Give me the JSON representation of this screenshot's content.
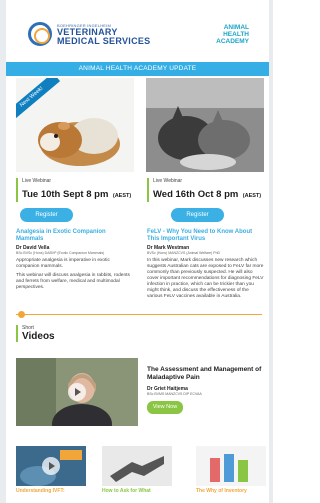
{
  "header": {
    "brand_small": "BOEHRINGER INGELHEIM",
    "brand_line1": "VETERINARY",
    "brand_line2": "MEDICAL SERVICES",
    "academy_line1": "ANIMAL",
    "academy_line2": "HEALTH",
    "academy_line3": "ACADEMY"
  },
  "banner": {
    "title": "ANIMAL HEALTH ACADEMY UPDATE"
  },
  "hero": {
    "ribbon": "Next Week!"
  },
  "webinars": [
    {
      "type": "Live Webinar",
      "date": "Tue 10th Sept 8 pm",
      "tz": "(AEST)",
      "button": "Register",
      "title": "Analgesia in Exotic Companion Mammals",
      "presenter": "Dr David Vella",
      "creds": "BSc BVSc (Hons) DABVP (Exotic Companion Mammals)",
      "paragraphs": [
        "Appropriate analgesia is imperative in exotic companion mammals.",
        "This webinar will discuss analgesia in rabbits, rodents and ferrets from welfare, medical and multimodal perspectives."
      ]
    },
    {
      "type": "Live Webinar",
      "date": "Wed 16th Oct 8 pm",
      "tz": "(AEST)",
      "button": "Register",
      "title": "FeLV - Why You Need to Know About This Important Virus",
      "presenter": "Dr Mark Westman",
      "creds": "BVSc (Hons) MANZCVS (Animal Welfare) PhD",
      "paragraphs": [
        "In this webinar, Mark discusses new research which suggests Australian cats are exposed to FeLV far more commonly than previously suspected. He will also cover important recommendations for diagnosing FeLV infection in practice, which can be trickier than you might think, and discuss the effectiveness of the various FeLV vaccines available in Australia."
      ]
    }
  ],
  "videos": {
    "label": "Short",
    "heading": "Videos",
    "feature": {
      "title": "The Assessment and Management of Maladaptive Pain",
      "presenter": "Dr Griet Haitjema",
      "creds": "BSc BVMS MANZCVS DIP ECVAA",
      "button": "View Now"
    },
    "thumbs": [
      {
        "label": "Understanding IVFT:"
      },
      {
        "label": "How to Ask for What"
      },
      {
        "label": "The Why of Inventory"
      }
    ]
  },
  "colors": {
    "accent_blue": "#34aee4",
    "accent_green": "#8ac643",
    "accent_orange": "#f2a63a",
    "brand_navy": "#24539a"
  }
}
